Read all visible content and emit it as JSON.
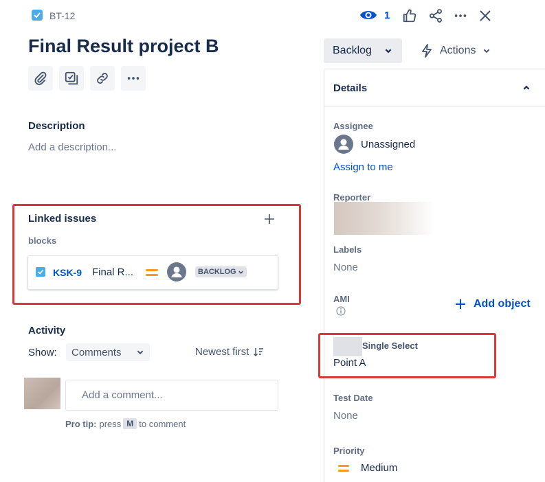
{
  "header": {
    "issue_key": "BT-12",
    "title": "Final Result project B",
    "watchers_count": "1"
  },
  "description": {
    "label": "Description",
    "placeholder": "Add a description..."
  },
  "linked_issues": {
    "label": "Linked issues",
    "relation": "blocks",
    "item": {
      "key": "KSK-9",
      "summary": "Final R...",
      "status": "BACKLOG"
    }
  },
  "activity": {
    "label": "Activity",
    "show_label": "Show:",
    "filter_value": "Comments",
    "sort_label": "Newest first",
    "comment_placeholder": "Add a comment...",
    "pro_tip_bold": "Pro tip:",
    "pro_tip_pre": "press",
    "pro_tip_key": "M",
    "pro_tip_post": "to comment"
  },
  "status": {
    "label": "Backlog"
  },
  "actions": {
    "label": "Actions"
  },
  "details": {
    "title": "Details",
    "assignee_label": "Assignee",
    "assignee_value": "Unassigned",
    "assign_to_me": "Assign to me",
    "reporter_label": "Reporter",
    "labels_label": "Labels",
    "labels_value": "None",
    "ami_label": "AMI",
    "add_object": "Add object",
    "single_select_label": "Single Select",
    "single_select_value": "Point A",
    "test_date_label": "Test Date",
    "test_date_value": "None",
    "priority_label": "Priority",
    "priority_value": "Medium"
  },
  "colors": {
    "accent": "#0052cc",
    "highlight": "#dc3838",
    "priority_medium": "#ff991f",
    "issue_icon": "#4bade8"
  }
}
